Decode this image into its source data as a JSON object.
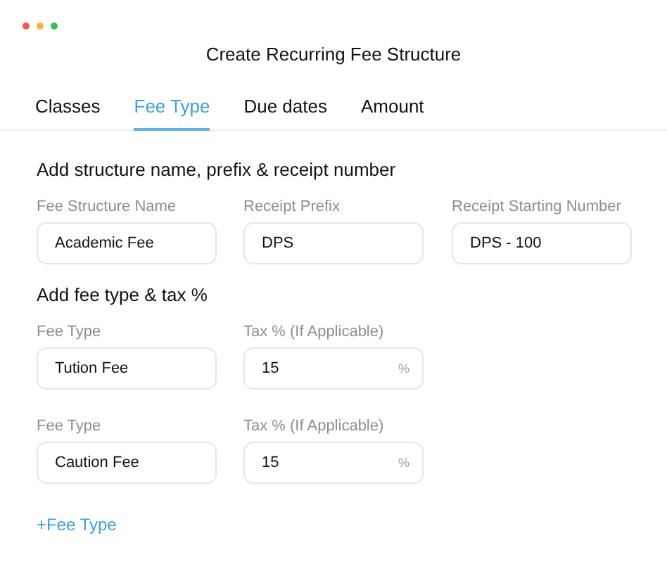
{
  "window": {
    "title": "Create Recurring Fee Structure"
  },
  "tabs": [
    {
      "label": "Classes",
      "selected": false
    },
    {
      "label": "Fee Type",
      "selected": true
    },
    {
      "label": "Due dates",
      "selected": false
    },
    {
      "label": "Amount",
      "selected": false
    }
  ],
  "structure_section": {
    "heading": "Add structure name, prefix & receipt number",
    "fields": [
      {
        "label": "Fee Structure Name",
        "value": "Academic Fee"
      },
      {
        "label": "Receipt Prefix",
        "value": "DPS"
      },
      {
        "label": "Receipt Starting Number",
        "value": "DPS - 100"
      }
    ]
  },
  "fee_section": {
    "heading": "Add fee type & tax %",
    "rows": [
      {
        "fee_label": "Fee Type",
        "fee_value": "Tution Fee",
        "tax_label": "Tax % (If Applicable)",
        "tax_value": "15",
        "tax_unit": "%"
      },
      {
        "fee_label": "Fee Type",
        "fee_value": "Caution Fee",
        "tax_label": "Tax % (If Applicable)",
        "tax_value": "15",
        "tax_unit": "%"
      }
    ],
    "add_link": "+Fee Type"
  }
}
